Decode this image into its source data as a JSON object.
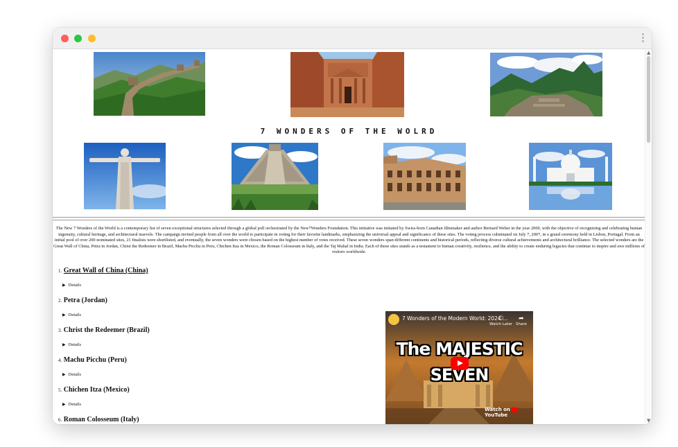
{
  "page": {
    "title": "7 WONDERS OF THE WOLRD",
    "intro": "The New 7 Wonders of the World is a contemporary list of seven exceptional structures selected through a global poll orchestrated by the New7Wonders Foundation. This initiative was initiated by Swiss-born Canadian filmmaker and author Bernard Weber in the year 2000, with the objective of recognizing and celebrating human ingenuity, cultural heritage, and architectural marvels. The campaign invited people from all over the world to participate in voting for their favorite landmarks, emphasizing the universal appeal and significance of these sites. The voting process culminated on July 7, 2007, in a grand ceremony held in Lisbon, Portugal. From an initial pool of over 200 nominated sites, 21 finalists were shortlisted, and eventually, the seven wonders were chosen based on the highest number of votes received. These seven wonders span different continents and historical periods, reflecting diverse cultural achievements and architectural brilliance. The selected wonders are the Great Wall of China, Petra in Jordan, Christ the Redeemer in Brazil, Machu Picchu in Peru, Chichen Itza in Mexico, the Roman Colosseum in Italy, and the Taj Mahal in India. Each of these sites stands as a testament to human creativity, resilience, and the ability to create enduring legacies that continue to inspire and awe millions of visitors worldwide."
  },
  "gallery": [
    {
      "name": "great-wall-image"
    },
    {
      "name": "petra-image"
    },
    {
      "name": "machu-picchu-image"
    },
    {
      "name": "christ-redeemer-image"
    },
    {
      "name": "chichen-itza-image"
    },
    {
      "name": "colosseum-image"
    },
    {
      "name": "taj-mahal-image"
    }
  ],
  "wonders": [
    {
      "num": "1.",
      "name": "Great Wall of China (China)",
      "details": "Details"
    },
    {
      "num": "2.",
      "name": "Petra (Jordan)",
      "details": "Details"
    },
    {
      "num": "3.",
      "name": "Christ the Redeemer (Brazil)",
      "details": "Details"
    },
    {
      "num": "4.",
      "name": "Machu Picchu (Peru)",
      "details": "Details"
    },
    {
      "num": "5.",
      "name": "Chichen Itza (Mexico)",
      "details": "Details"
    },
    {
      "num": "6.",
      "name": "Roman Colosseum (Italy)",
      "details": ""
    }
  ],
  "video": {
    "title": "7 Wonders of the Modern World: 2024 ...",
    "headline_1": "The MAJESTIC",
    "headline_2": "SEVEN",
    "watch_later": "Watch Later",
    "share": "Share",
    "watch_on": "Watch on",
    "youtube": "YouTube"
  },
  "colors": {
    "close": "#ff5f57",
    "minimize": "#28c840",
    "maximize": "#febc2e",
    "youtube_red": "#ff0000"
  }
}
